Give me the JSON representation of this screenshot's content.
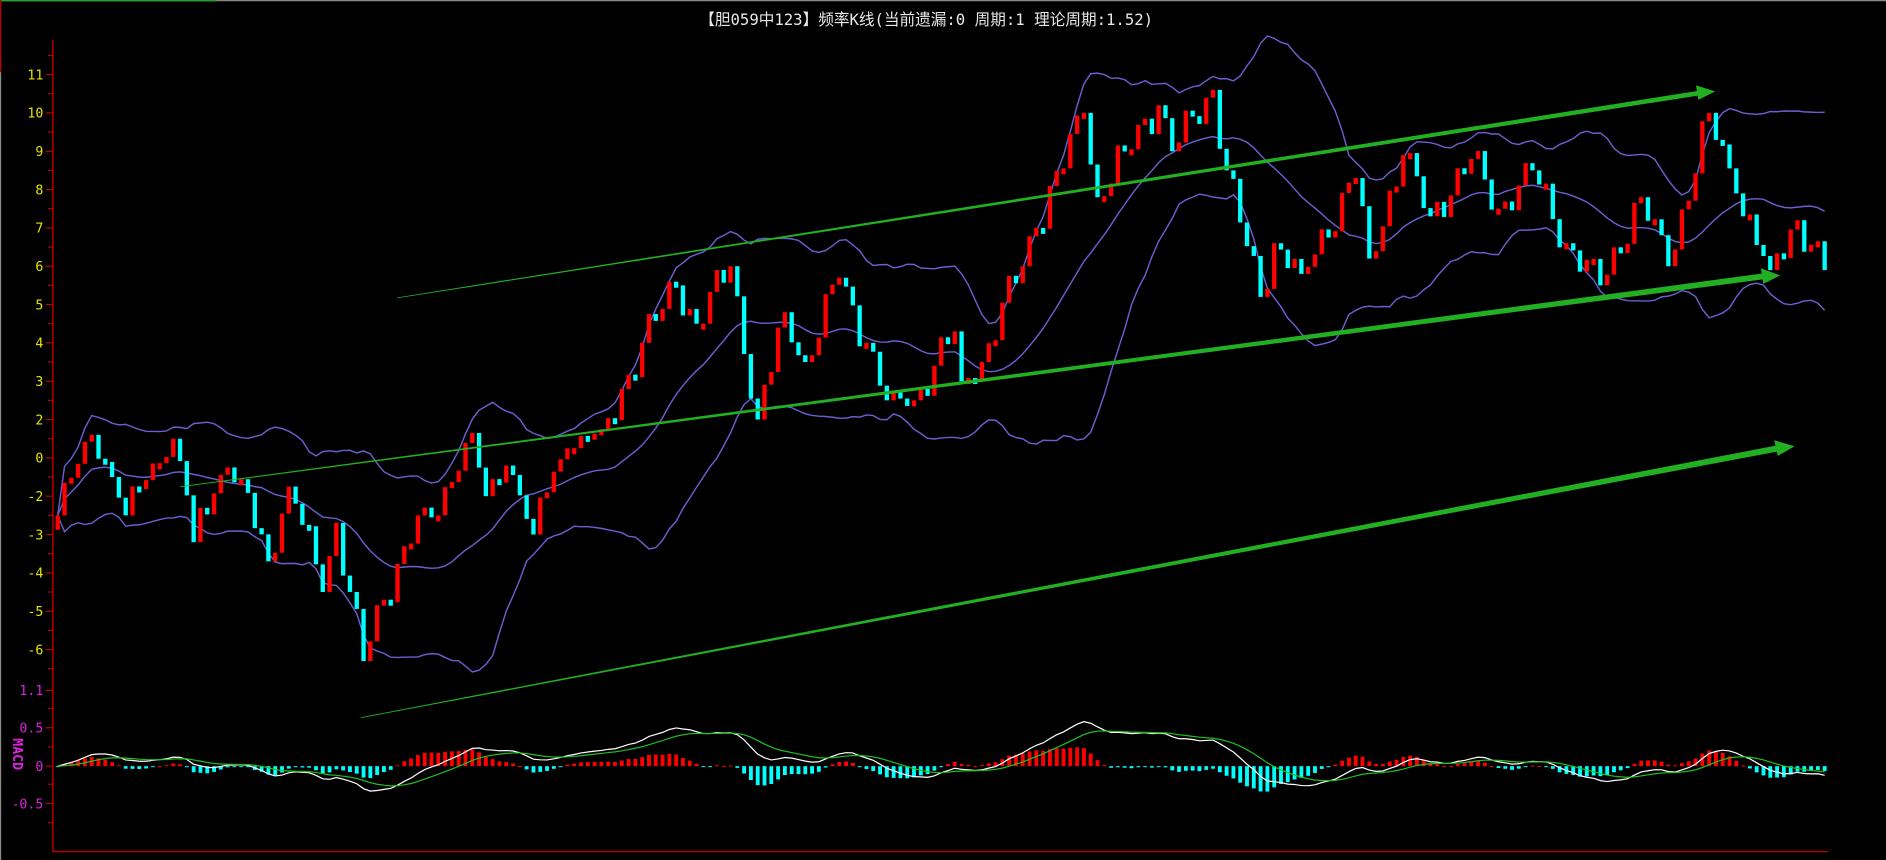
{
  "title": "【胆059中123】频率K线(当前遗漏:0 周期:1 理论周期:1.52)",
  "colors": {
    "up": "#ff0000",
    "down": "#00ffff",
    "band": "#6a5fd0",
    "axis": "#c00000",
    "price_label": "#e6e600",
    "macd_label": "#e020e0",
    "dif": "#ffffff",
    "dea": "#20c020",
    "trend": "#22b022"
  },
  "y_axis": {
    "ticks": [
      "11",
      "10",
      "9",
      "8",
      "7",
      "6",
      "5",
      "4",
      "3",
      "2",
      "0",
      "-2",
      "-3",
      "-4",
      "-5",
      "-6"
    ]
  },
  "macd_axis": {
    "label": "MACD",
    "ticks": [
      "1.1",
      "0.5",
      "0",
      "-0.5"
    ]
  },
  "chart_data": {
    "type": "candlestick",
    "title": "【胆059中123】频率K线(当前遗漏:0 周期:1 理论周期:1.52)",
    "bar_count": 261,
    "overlays": [
      "Bollinger(20,2)",
      "MACD(12,26,9)"
    ],
    "waypoints": [
      [
        0,
        -2.5
      ],
      [
        5,
        1.2
      ],
      [
        8,
        -1
      ],
      [
        10,
        -2.5
      ],
      [
        17,
        1
      ],
      [
        20,
        -3.2
      ],
      [
        25,
        -0.5
      ],
      [
        31,
        -3.7
      ],
      [
        34,
        -1.5
      ],
      [
        39,
        -4.5
      ],
      [
        41,
        -2.7
      ],
      [
        45,
        -6.3
      ],
      [
        48,
        -4.7
      ],
      [
        53,
        -2.5
      ],
      [
        56,
        -2.5
      ],
      [
        61,
        1.3
      ],
      [
        63,
        -2
      ],
      [
        66,
        -0.4
      ],
      [
        70,
        -3
      ],
      [
        75,
        0.5
      ],
      [
        80,
        1.5
      ],
      [
        86,
        4
      ],
      [
        91,
        5.5
      ],
      [
        94,
        4.5
      ],
      [
        99,
        6
      ],
      [
        103,
        2
      ],
      [
        107,
        4.8
      ],
      [
        110,
        3.5
      ],
      [
        115,
        5.7
      ],
      [
        119,
        4
      ],
      [
        122,
        2.5
      ],
      [
        126,
        2.5
      ],
      [
        132,
        4.3
      ],
      [
        133,
        3
      ],
      [
        136,
        3.5
      ],
      [
        144,
        7
      ],
      [
        151,
        10
      ],
      [
        153,
        7.8
      ],
      [
        157,
        9
      ],
      [
        162,
        10.2
      ],
      [
        164,
        9
      ],
      [
        170,
        10.6
      ],
      [
        172,
        8.5
      ],
      [
        177,
        5.2
      ],
      [
        179,
        6.6
      ],
      [
        183,
        5.8
      ],
      [
        191,
        8.3
      ],
      [
        193,
        6.2
      ],
      [
        198,
        8.9
      ],
      [
        202,
        7.3
      ],
      [
        208,
        8.8
      ],
      [
        212,
        7.5
      ],
      [
        217,
        8.5
      ],
      [
        222,
        6.6
      ],
      [
        227,
        5.5
      ],
      [
        233,
        7.8
      ],
      [
        237,
        6
      ],
      [
        243,
        10
      ],
      [
        247,
        7.9
      ],
      [
        252,
        5.9
      ],
      [
        256,
        7.2
      ],
      [
        260,
        5.9
      ]
    ]
  }
}
